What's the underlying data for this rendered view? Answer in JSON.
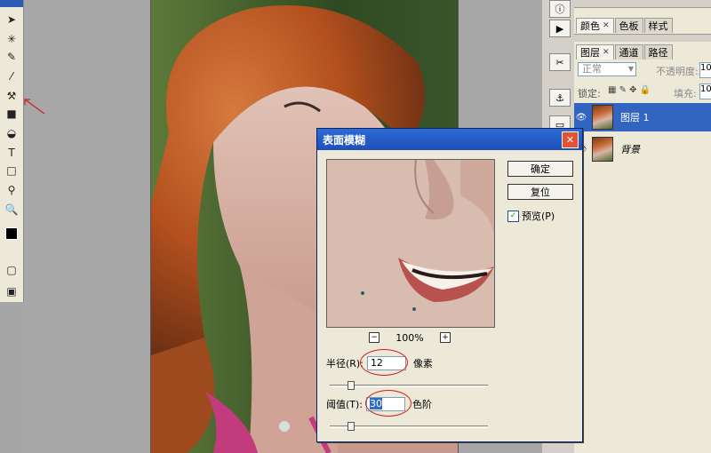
{
  "dialog": {
    "title": "表面模糊",
    "ok_label": "确定",
    "reset_label": "复位",
    "preview_label": "预览(P)",
    "zoom": "100%",
    "radius": {
      "label": "半径(R):",
      "value": "12",
      "unit": "像素",
      "slider_fraction": 0.12
    },
    "threshold": {
      "label": "阈值(T):",
      "value": "30",
      "unit": "色阶",
      "slider_fraction": 0.12
    }
  },
  "panels": {
    "top_tabs": [
      {
        "label": "颜色"
      },
      {
        "label": "色板"
      },
      {
        "label": "样式"
      }
    ],
    "layer_tabs": [
      {
        "label": "图层"
      },
      {
        "label": "通道"
      },
      {
        "label": "路径"
      }
    ],
    "blend_mode": "正常",
    "opacity_label": "不透明度:",
    "opacity_value": "10",
    "lock_label": "锁定:",
    "fill_label": "填充:",
    "fill_value": "10",
    "layers": [
      {
        "name": "图层 1",
        "selected": true
      },
      {
        "name": "背景",
        "selected": false
      }
    ]
  },
  "colors": {
    "titlebar": "#1e4fb8",
    "selected_layer": "#3264c2",
    "annotation": "#cc2222"
  }
}
